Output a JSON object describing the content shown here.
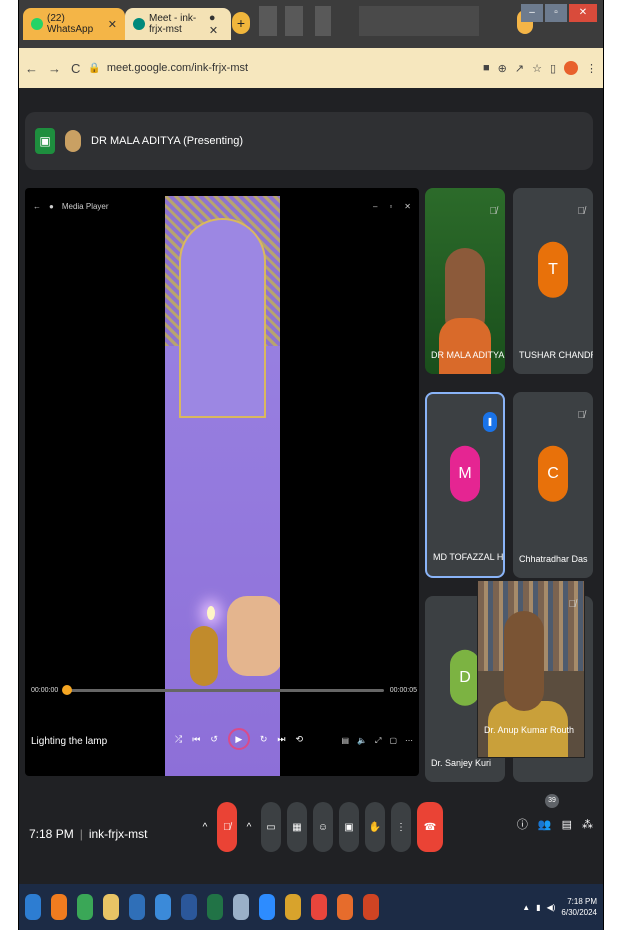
{
  "browser": {
    "tabs": [
      {
        "title": "(22) WhatsApp",
        "color": "#25d366"
      },
      {
        "title": "Meet - ink-frjx-mst",
        "color": "#00897b"
      }
    ],
    "address": "meet.google.com/ink-frjx-mst"
  },
  "presenter_bar": {
    "text": "DR MALA ADITYA (Presenting)"
  },
  "media_player": {
    "title": "Media Player",
    "time_start": "00:00:00",
    "time_end": "00:00:05",
    "caption": "Lighting the lamp",
    "progress": 0.0
  },
  "participants": [
    {
      "name": "DR MALA ADITYA",
      "type": "video"
    },
    {
      "name": "TUSHAR CHANDRA...",
      "initial": "T",
      "color": "#e8710a"
    },
    {
      "name": "MD TOFAZZAL HA...",
      "initial": "M",
      "color": "#e52592",
      "speaking": true
    },
    {
      "name": "Chhatradhar Das",
      "initial": "C",
      "color": "#e8710a"
    },
    {
      "name": "Dr. Sanjey Kuri",
      "initial": "D",
      "color": "#7cb342"
    },
    {
      "name": "Dr. Anup Kumar Routh",
      "type": "video"
    }
  ],
  "call": {
    "time": "7:18 PM",
    "meeting_code": "ink-frjx-mst",
    "people_count": "39"
  },
  "taskbar": {
    "time": "7:18 PM",
    "date": "6/30/2024"
  }
}
